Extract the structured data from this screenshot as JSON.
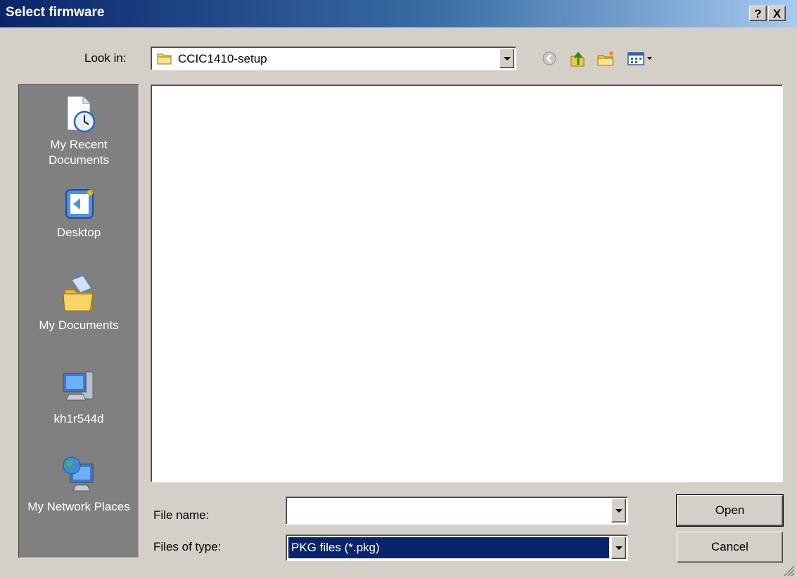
{
  "window": {
    "title": "Select firmware",
    "help_label": "?",
    "close_label": "X"
  },
  "lookin": {
    "label": "Look in:",
    "value": "CCIC1410-setup",
    "icon": "folder-icon"
  },
  "toolbar": {
    "back_icon": "back-icon",
    "up_icon": "up-folder-icon",
    "new_folder_icon": "new-folder-icon",
    "view_icon": "view-menu-icon"
  },
  "places": [
    {
      "label": "My Recent Documents",
      "icon": "recent-documents-icon"
    },
    {
      "label": "Desktop",
      "icon": "desktop-icon"
    },
    {
      "label": "My Documents",
      "icon": "my-documents-icon"
    },
    {
      "label": "kh1r544d",
      "icon": "computer-icon"
    },
    {
      "label": "My Network Places",
      "icon": "network-places-icon"
    }
  ],
  "filename": {
    "label": "File name:",
    "value": ""
  },
  "filetype": {
    "label": "Files of type:",
    "value": "PKG files (*.pkg)"
  },
  "buttons": {
    "open": "Open",
    "cancel": "Cancel"
  }
}
